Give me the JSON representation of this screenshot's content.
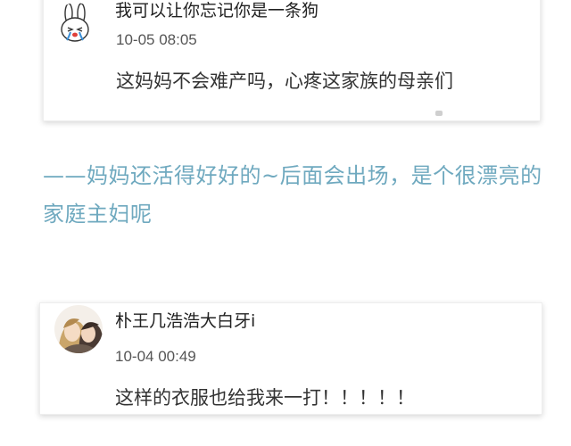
{
  "comments": [
    {
      "username": "我可以让你忘记你是一条狗",
      "timestamp": "10-05 08:05",
      "text": "这妈妈不会难产吗，心疼这家族的母亲们",
      "avatar_icon": "rabbit-crying-avatar-icon"
    },
    {
      "username": "朴王几浩浩大白牙i",
      "timestamp": "10-04 00:49",
      "text": "这样的衣服也给我来一打！！！！！",
      "avatar_icon": "anime-couple-avatar-icon"
    }
  ],
  "reply": {
    "text": "——妈妈还活得好好的~后面会出场，是个很漂亮的家庭主妇呢",
    "color": "#6fa9bf"
  }
}
